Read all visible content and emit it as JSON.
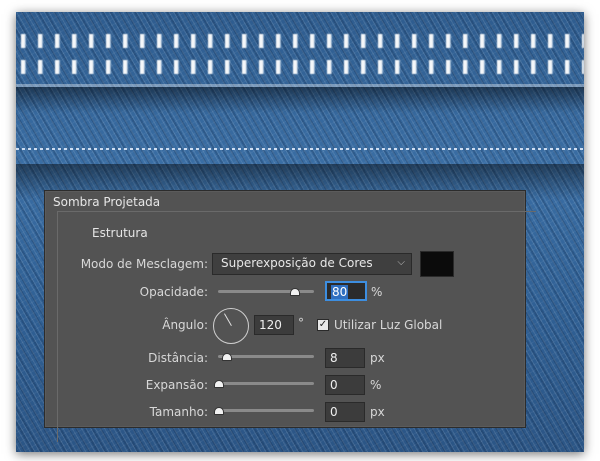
{
  "panel": {
    "title": "Sombra Projetada",
    "section": "Estrutura"
  },
  "blend": {
    "label": "Modo de Mesclagem:",
    "value": "Superexposição de Cores",
    "swatch_color": "#0b0b0b"
  },
  "opacity": {
    "label": "Opacidade:",
    "value": "80",
    "unit": "%",
    "level_percent": 80
  },
  "angle": {
    "label": "Ângulo:",
    "value": "120",
    "unit": "°",
    "global_light_label": "Utilizar Luz Global",
    "global_light_checked": true
  },
  "distance": {
    "label": "Distância:",
    "value": "8",
    "unit": "px"
  },
  "spread": {
    "label": "Expansão:",
    "value": "0",
    "unit": "%"
  },
  "size": {
    "label": "Tamanho:",
    "value": "0",
    "unit": "px"
  },
  "icons": {
    "dropdown": "chevron-down-icon",
    "checkbox": "checkmark-icon"
  }
}
